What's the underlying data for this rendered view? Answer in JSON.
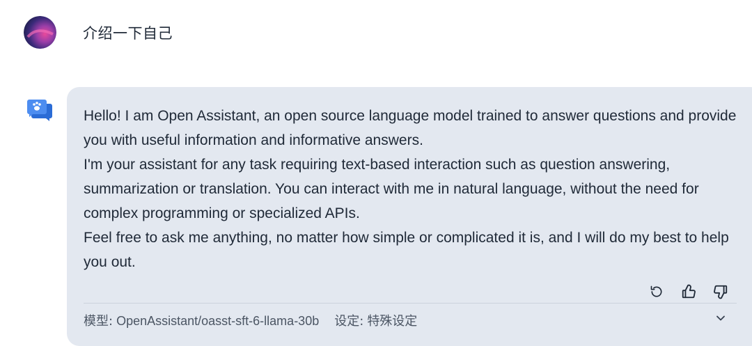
{
  "user_message": {
    "avatar": "gradient-avatar",
    "text": "介绍一下自己"
  },
  "assistant_message": {
    "icon": "assistant-chat-icon",
    "paragraphs": [
      "Hello! I am Open Assistant, an open source language model trained to answer questions and provide you with useful information and informative answers.",
      "I'm your assistant for any task requiring text-based interaction such as question answering, summarization or translation. You can interact with me in natural language, without the need for complex programming or specialized APIs.",
      "Feel free to ask me anything, no matter how simple or complicated it is, and I will do my best to help you out."
    ],
    "actions": [
      "regenerate-icon",
      "thumbs-up-icon",
      "thumbs-down-icon"
    ],
    "meta": {
      "model_label": "模型:",
      "model_value": "OpenAssistant/oasst-sft-6-llama-30b",
      "preset_label": "设定:",
      "preset_value": "特殊设定"
    }
  },
  "colors": {
    "bubble_bg": "#e3e8f0",
    "assistant_icon": "#3b82f6",
    "text": "#1f2937",
    "meta_text": "#4b5563"
  }
}
